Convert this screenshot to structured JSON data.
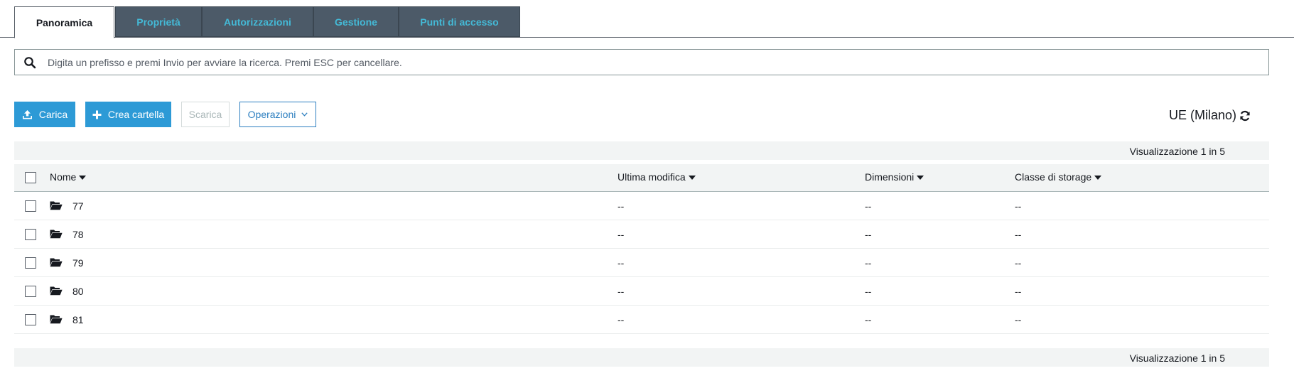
{
  "tabs": [
    {
      "label": "Panoramica",
      "active": true
    },
    {
      "label": "Proprietà",
      "active": false
    },
    {
      "label": "Autorizzazioni",
      "active": false
    },
    {
      "label": "Gestione",
      "active": false
    },
    {
      "label": "Punti di accesso",
      "active": false
    }
  ],
  "search": {
    "placeholder": "Digita un prefisso e premi Invio per avviare la ricerca. Premi ESC per cancellare.",
    "value": ""
  },
  "toolbar": {
    "upload_label": "Carica",
    "create_folder_label": "Crea cartella",
    "download_label": "Scarica",
    "actions_label": "Operazioni",
    "region": "UE (Milano)"
  },
  "summary": {
    "top": "Visualizzazione 1 in 5",
    "bottom": "Visualizzazione 1 in 5"
  },
  "table": {
    "columns": [
      "Nome",
      "Ultima modifica",
      "Dimensioni",
      "Classe di storage"
    ],
    "rows": [
      {
        "name": "77",
        "modified": "--",
        "size": "--",
        "storage": "--"
      },
      {
        "name": "78",
        "modified": "--",
        "size": "--",
        "storage": "--"
      },
      {
        "name": "79",
        "modified": "--",
        "size": "--",
        "storage": "--"
      },
      {
        "name": "80",
        "modified": "--",
        "size": "--",
        "storage": "--"
      },
      {
        "name": "81",
        "modified": "--",
        "size": "--",
        "storage": "--"
      }
    ]
  },
  "colors": {
    "accent": "#2d9ad6",
    "tab_inactive_bg": "#4c5a68",
    "tab_inactive_text": "#44b9d6",
    "summary_bg": "#f2f4f4"
  },
  "icons": {
    "search": "search-icon",
    "upload": "upload-icon",
    "plus": "plus-icon",
    "chevron": "chevron-down-icon",
    "refresh": "refresh-icon",
    "folder": "folder-open-icon",
    "sort": "sort-caret-icon"
  }
}
